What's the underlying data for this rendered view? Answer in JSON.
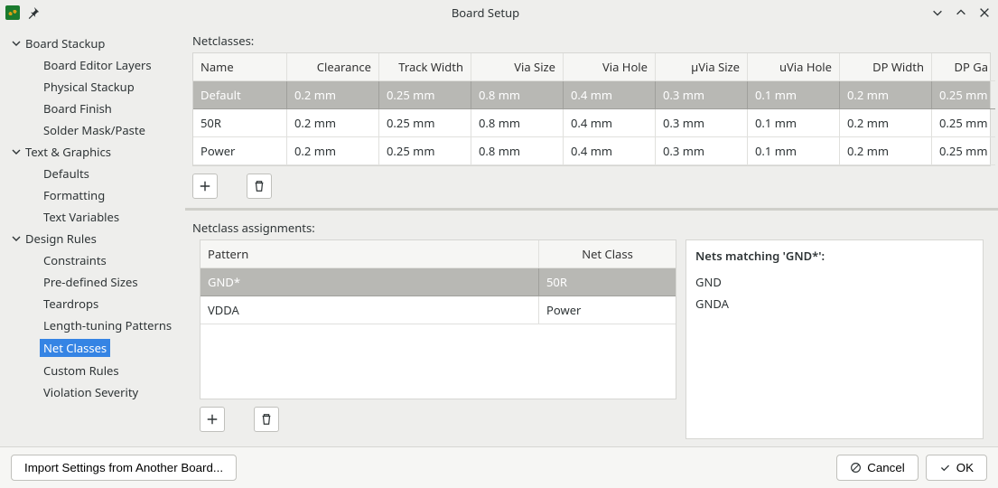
{
  "window": {
    "title": "Board Setup"
  },
  "sidebar": {
    "sections": [
      {
        "label": "Board Stackup",
        "items": [
          "Board Editor Layers",
          "Physical Stackup",
          "Board Finish",
          "Solder Mask/Paste"
        ]
      },
      {
        "label": "Text & Graphics",
        "items": [
          "Defaults",
          "Formatting",
          "Text Variables"
        ]
      },
      {
        "label": "Design Rules",
        "items": [
          "Constraints",
          "Pre-defined Sizes",
          "Teardrops",
          "Length-tuning Patterns",
          "Net Classes",
          "Custom Rules",
          "Violation Severity"
        ],
        "selected": "Net Classes"
      }
    ]
  },
  "netclasses": {
    "title": "Netclasses:",
    "columns": [
      "Name",
      "Clearance",
      "Track Width",
      "Via Size",
      "Via Hole",
      "µVia Size",
      "uVia Hole",
      "DP Width",
      "DP Ga"
    ],
    "rows": [
      {
        "name": "Default",
        "selected": true,
        "cells": [
          "0.2 mm",
          "0.25 mm",
          "0.8 mm",
          "0.4 mm",
          "0.3 mm",
          "0.1 mm",
          "0.2 mm",
          "0.25 mm"
        ]
      },
      {
        "name": "50R",
        "selected": false,
        "cells": [
          "0.2 mm",
          "0.25 mm",
          "0.8 mm",
          "0.4 mm",
          "0.3 mm",
          "0.1 mm",
          "0.2 mm",
          "0.25 mm"
        ]
      },
      {
        "name": "Power",
        "selected": false,
        "cells": [
          "0.2 mm",
          "0.25 mm",
          "0.8 mm",
          "0.4 mm",
          "0.3 mm",
          "0.1 mm",
          "0.2 mm",
          "0.25 mm"
        ]
      }
    ]
  },
  "assignments": {
    "title": "Netclass assignments:",
    "columns": [
      "Pattern",
      "Net Class"
    ],
    "rows": [
      {
        "pattern": "GND*",
        "netclass": "50R",
        "selected": true
      },
      {
        "pattern": "VDDA",
        "netclass": "Power",
        "selected": false
      }
    ]
  },
  "matching": {
    "title": "Nets matching 'GND*':",
    "nets": [
      "GND",
      "GNDA"
    ]
  },
  "footer": {
    "import": "Import Settings from Another Board...",
    "cancel": "Cancel",
    "ok": "OK"
  }
}
